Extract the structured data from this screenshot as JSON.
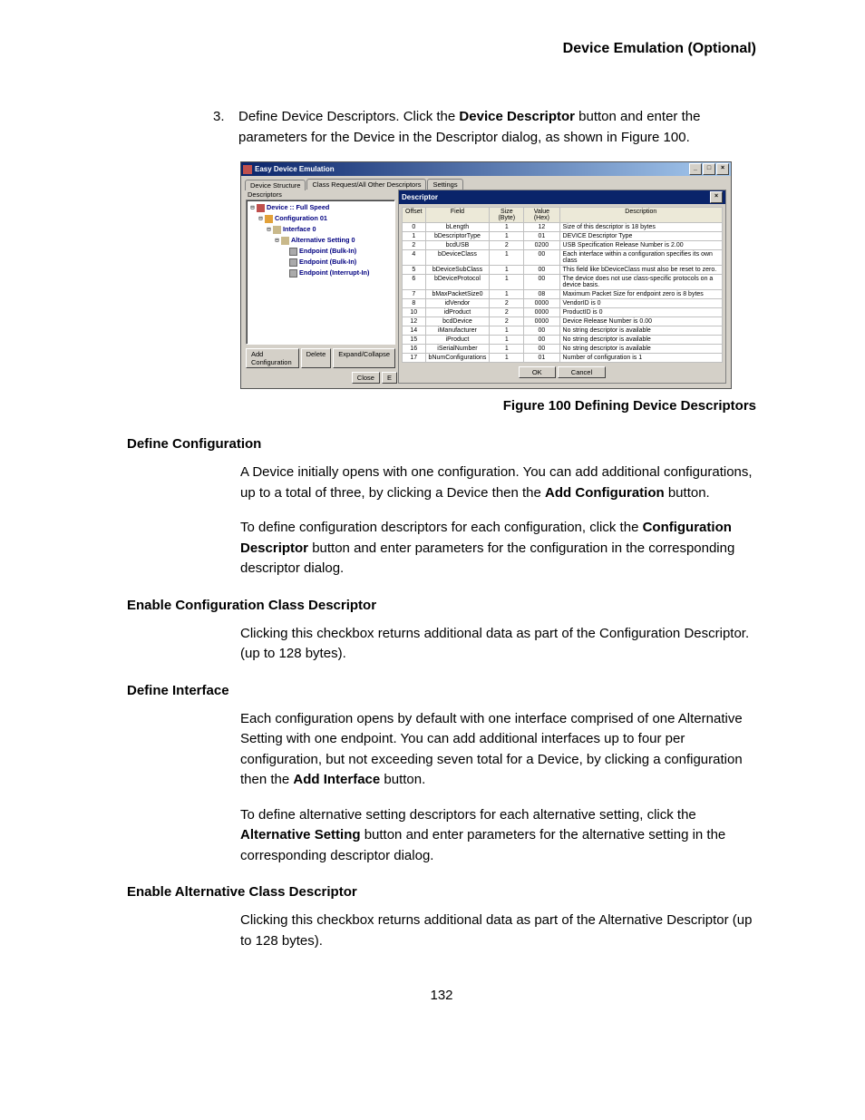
{
  "header": "Device Emulation (Optional)",
  "step": {
    "num": "3.",
    "text_a": "Define Device Descriptors. Click the ",
    "text_b": "Device Descriptor",
    "text_c": " button and enter the parameters for the Device in the Descriptor dialog, as shown in Figure 100."
  },
  "figure_caption": "Figure  100  Defining Device Descriptors",
  "sections": {
    "s1": {
      "title": "Define Configuration",
      "p1_a": "A Device initially opens with one configuration. You can add additional configurations, up to a total of three, by clicking a Device then the ",
      "p1_b": "Add Configuration",
      "p1_c": " button.",
      "p2_a": "To define configuration descriptors for each configuration, click the ",
      "p2_b": "Configuration Descriptor",
      "p2_c": " button and enter parameters for the configuration in the corresponding descriptor dialog."
    },
    "s2": {
      "title": "Enable Configuration Class Descriptor",
      "p1": "Clicking this checkbox returns additional data as part of the Configuration Descriptor. (up to 128 bytes)."
    },
    "s3": {
      "title": "Define Interface",
      "p1_a": "Each configuration opens by default with one interface comprised of one Alternative Setting with one endpoint. You can add additional interfaces up to four per configuration, but not exceeding seven total for a Device, by clicking a configuration then the ",
      "p1_b": "Add Interface",
      "p1_c": " button.",
      "p2_a": "To define alternative setting descriptors for each alternative setting, click the ",
      "p2_b": "Alternative Setting",
      "p2_c": " button and enter parameters for the alternative setting in the corresponding descriptor dialog."
    },
    "s4": {
      "title": "Enable Alternative Class Descriptor",
      "p1": "Clicking this checkbox returns additional data as part of the Alternative Descriptor (up to 128 bytes)."
    }
  },
  "page_number": "132",
  "window": {
    "title": "Easy Device Emulation",
    "tabs": [
      "Device Structure",
      "Class Request/All Other Descriptors",
      "Settings"
    ],
    "descriptors_label": "Descriptors",
    "tree": {
      "n0": "Device :: Full Speed",
      "n1": "Configuration 01",
      "n2": "Interface 0",
      "n3": "Alternative Setting 0",
      "n4": "Endpoint (Bulk-In)",
      "n5": "Endpoint (Bulk-In)",
      "n6": "Endpoint (Interrupt-In)"
    },
    "buttons": {
      "add": "Add Configuration",
      "del": "Delete",
      "exp": "Expand/Collapse",
      "close": "Close",
      "e": "E"
    },
    "descriptor_dialog": {
      "title": "Descriptor",
      "headers": {
        "offset": "Offset",
        "field": "Field",
        "size": "Size (Byte)",
        "value": "Value (Hex)",
        "desc": "Description"
      },
      "buttons": {
        "ok": "OK",
        "cancel": "Cancel"
      },
      "rows": [
        {
          "offset": "0",
          "field": "bLength",
          "size": "1",
          "value": "12",
          "desc": "Size of this descriptor is 18 bytes"
        },
        {
          "offset": "1",
          "field": "bDescriptorType",
          "size": "1",
          "value": "01",
          "desc": "DEVICE Descriptor Type"
        },
        {
          "offset": "2",
          "field": "bcdUSB",
          "size": "2",
          "value": "0200",
          "desc": "USB Specification Release Number is 2.00"
        },
        {
          "offset": "4",
          "field": "bDeviceClass",
          "size": "1",
          "value": "00",
          "desc": "Each interface within a configuration specifies its own class"
        },
        {
          "offset": "5",
          "field": "bDeviceSubClass",
          "size": "1",
          "value": "00",
          "desc": "This field like bDeviceClass must also be reset to zero."
        },
        {
          "offset": "6",
          "field": "bDeviceProtocol",
          "size": "1",
          "value": "00",
          "desc": "The device does not use class-specific protocols on a device basis."
        },
        {
          "offset": "7",
          "field": "bMaxPacketSize0",
          "size": "1",
          "value": "08",
          "desc": "Maximum Packet Size for endpoint zero is 8 bytes"
        },
        {
          "offset": "8",
          "field": "idVendor",
          "size": "2",
          "value": "0000",
          "desc": "VendorID is 0"
        },
        {
          "offset": "10",
          "field": "idProduct",
          "size": "2",
          "value": "0000",
          "desc": "ProductID is 0"
        },
        {
          "offset": "12",
          "field": "bcdDevice",
          "size": "2",
          "value": "0000",
          "desc": "Device Release Number is 0.00"
        },
        {
          "offset": "14",
          "field": "iManufacturer",
          "size": "1",
          "value": "00",
          "desc": "No string descriptor is available"
        },
        {
          "offset": "15",
          "field": "iProduct",
          "size": "1",
          "value": "00",
          "desc": "No string descriptor is available"
        },
        {
          "offset": "16",
          "field": "iSerialNumber",
          "size": "1",
          "value": "00",
          "desc": "No string descriptor is available"
        },
        {
          "offset": "17",
          "field": "bNumConfigurations",
          "size": "1",
          "value": "01",
          "desc": "Number of configuration is 1"
        }
      ]
    }
  }
}
